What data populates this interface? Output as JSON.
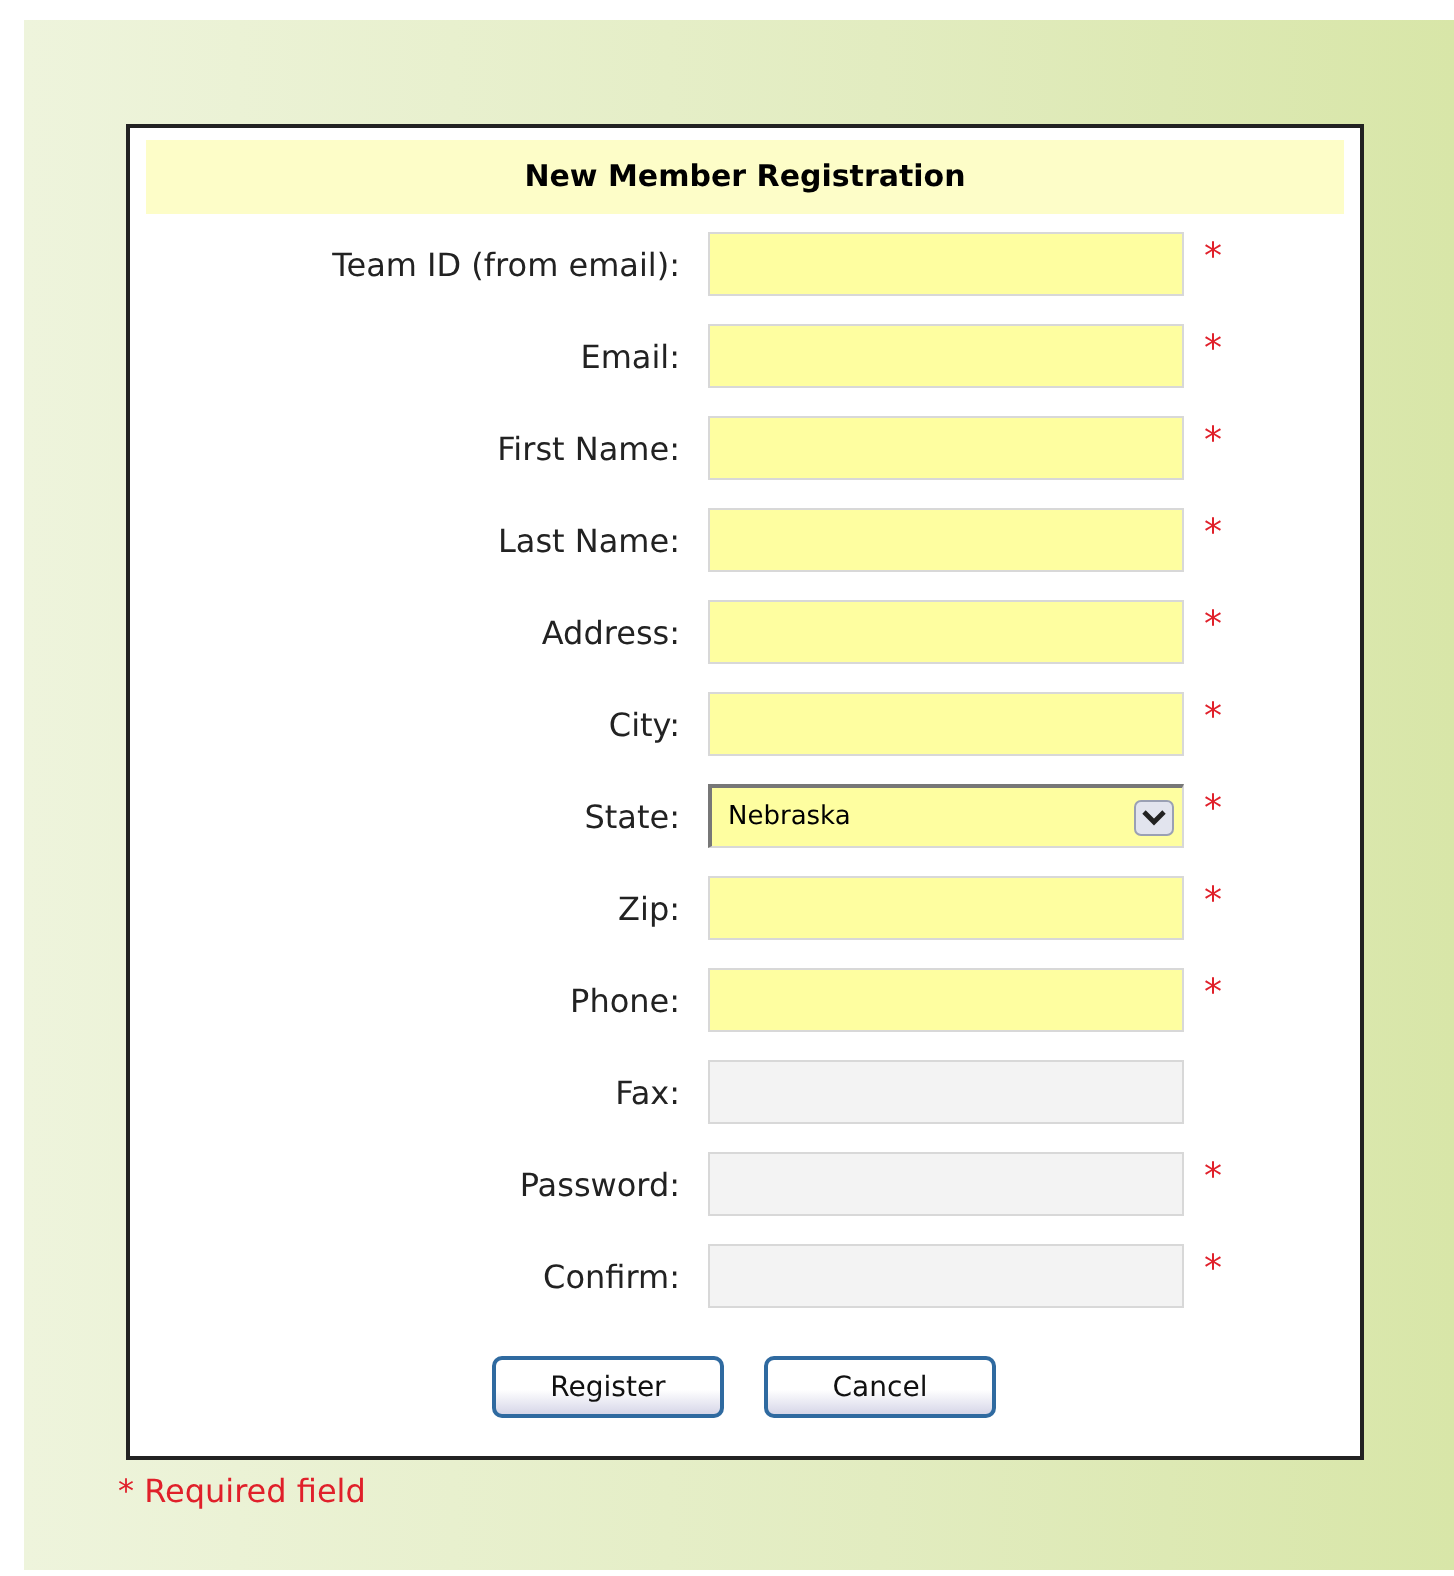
{
  "form": {
    "title": "New Member Registration",
    "fields": [
      {
        "label": "Team ID (from email):",
        "kind": "text",
        "highlighted": true,
        "required_mark": "*"
      },
      {
        "label": "Email:",
        "kind": "text",
        "highlighted": true,
        "required_mark": "*"
      },
      {
        "label": "First Name:",
        "kind": "text",
        "highlighted": true,
        "required_mark": "*"
      },
      {
        "label": "Last Name:",
        "kind": "text",
        "highlighted": true,
        "required_mark": "*"
      },
      {
        "label": "Address:",
        "kind": "text",
        "highlighted": true,
        "required_mark": "*"
      },
      {
        "label": "City:",
        "kind": "text",
        "highlighted": true,
        "required_mark": "*"
      },
      {
        "label": "State:",
        "kind": "select",
        "value": "Nebraska",
        "highlighted": true,
        "required_mark": "*"
      },
      {
        "label": "Zip:",
        "kind": "text",
        "highlighted": true,
        "required_mark": "*"
      },
      {
        "label": "Phone:",
        "kind": "text",
        "highlighted": true,
        "required_mark": "*"
      },
      {
        "label": "Fax:",
        "kind": "text",
        "highlighted": false
      },
      {
        "label": "Password:",
        "kind": "password",
        "highlighted": false,
        "required_mark": "*"
      },
      {
        "label": "Confirm:",
        "kind": "password",
        "highlighted": false,
        "required_mark": "*"
      }
    ],
    "buttons": [
      "Register",
      "Cancel"
    ]
  },
  "footnote": "* Required field"
}
